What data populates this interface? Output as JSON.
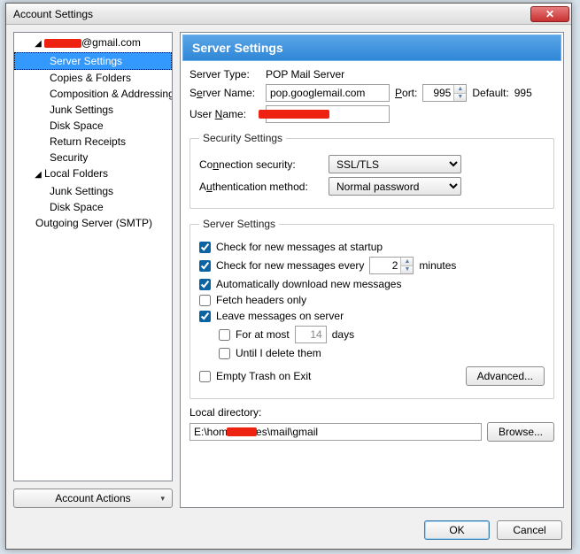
{
  "window": {
    "title": "Account Settings"
  },
  "titlebar": {
    "close_glyph": "✕"
  },
  "tree": {
    "account_suffix": "@gmail.com",
    "items": {
      "server_settings": "Server Settings",
      "copies_folders": "Copies & Folders",
      "composition": "Composition & Addressing",
      "junk": "Junk Settings",
      "disk": "Disk Space",
      "receipts": "Return Receipts",
      "security": "Security",
      "local_folders": "Local Folders",
      "lf_junk": "Junk Settings",
      "lf_disk": "Disk Space",
      "smtp": "Outgoing Server (SMTP)"
    },
    "twisty_open": "◢",
    "account_actions": "Account Actions"
  },
  "content": {
    "title": "Server Settings",
    "labels": {
      "server_type": "Server Type:",
      "server_name_pre": "S",
      "server_name_ul": "e",
      "server_name_post": "rver Name:",
      "port_ul": "P",
      "port_post": "ort:",
      "default": "Default:",
      "user_name_pre": "User ",
      "user_name_ul": "N",
      "user_name_post": "ame:",
      "conn_sec_pre": "Co",
      "conn_sec_ul": "n",
      "conn_sec_post": "nection security:",
      "auth_pre": "A",
      "auth_ul": "u",
      "auth_post": "thentication method:",
      "local_dir_pre": "Local director",
      "local_dir_ul": "y",
      "local_dir_post": ":"
    },
    "values": {
      "server_type": "POP Mail Server",
      "server_name": "pop.googlemail.com",
      "port": "995",
      "default_port": "995",
      "user_name": "",
      "local_dir_pre": "E:\\hom",
      "local_dir_post": "iles\\mail\\gmail"
    },
    "security_legend": "Security Settings",
    "conn_sec_option": "SSL/TLS",
    "auth_option": "Normal password",
    "server_legend": "Server Settings",
    "checks": {
      "startup_ul": "C",
      "startup_post": "heck for new messages at startup",
      "every_pre": "Check for new messages every",
      "every_value": "2",
      "every_unit": "minutes",
      "autodl_pre": "Auto",
      "autodl_ul": "m",
      "autodl_post": "atically download new messages",
      "fetch_ul": "F",
      "fetch_post": "etch headers only",
      "leave_ul": "L",
      "leave_post": "eave messages on server",
      "for_at_most_pre": "F",
      "for_at_most_ul": "o",
      "for_at_most_post": "r at most",
      "for_at_most_value": "14",
      "for_at_most_unit": "days",
      "until_pre": "Until I ",
      "until_ul": "d",
      "until_post": "elete them",
      "empty_pre": "Empty Trash on E",
      "empty_ul": "x",
      "empty_post": "it"
    },
    "buttons": {
      "advanced": "Advanced...",
      "browse_ul": "B",
      "browse_post": "rowse..."
    }
  },
  "footer": {
    "ok": "OK",
    "cancel": "Cancel"
  },
  "spin_arrows": {
    "up": "▲",
    "down": "▼"
  }
}
